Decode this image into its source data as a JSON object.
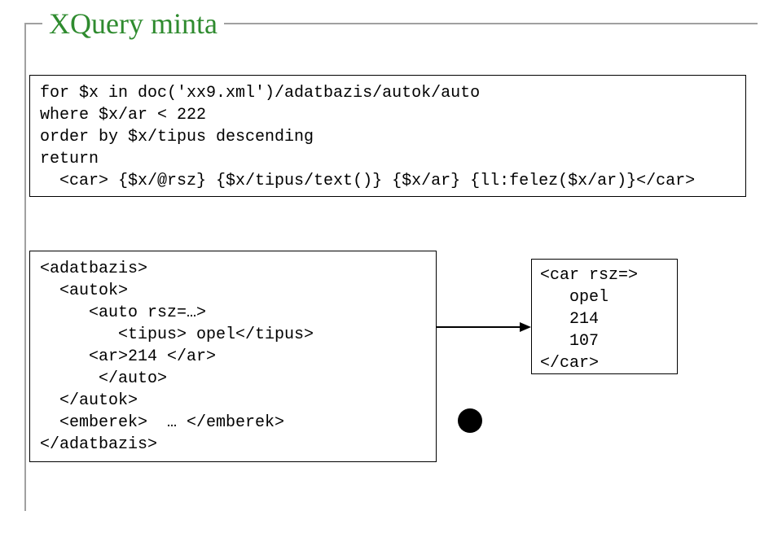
{
  "title": "XQuery minta",
  "query_code": "for $x in doc('xx9.xml')/adatbazis/autok/auto\nwhere $x/ar < 222\norder by $x/tipus descending\nreturn\n  <car> {$x/@rsz} {$x/tipus/text()} {$x/ar} {ll:felez($x/ar)}</car>",
  "input_xml": "<adatbazis>\n  <autok>\n     <auto rsz=…>\n        <tipus> opel</tipus>\n     <ar>214 </ar>\n      </auto>\n  </autok>\n  <emberek>  … </emberek>\n</adatbazis>",
  "output_xml": "<car rsz=>\n   opel\n   214\n   107\n</car>"
}
